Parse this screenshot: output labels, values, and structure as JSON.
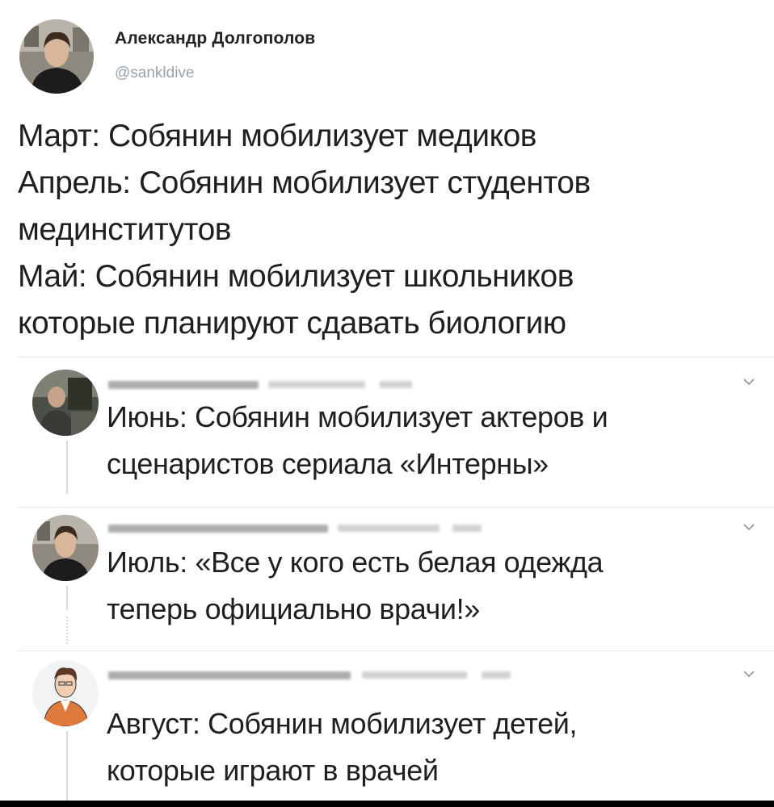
{
  "tweet": {
    "author_name": "Александр Долгополов",
    "author_handle": "@sankldive",
    "lines": [
      "Март: Собянин мобилизует медиков",
      "Апрель: Собянин мобилизует студентов",
      "мединститутов",
      "Май: Собянин мобилизует школьников",
      "которые планируют сдавать биологию"
    ]
  },
  "replies": [
    {
      "lines": [
        "Июнь: Собянин мобилизует актеров и",
        "сценаристов сериала «Интерны»"
      ]
    },
    {
      "lines": [
        "Июль: «Все у кого есть белая одежда",
        "теперь официально врачи!»"
      ]
    },
    {
      "lines": [
        "Август: Собянин мобилизует детей,",
        "которые играют в врачей"
      ]
    }
  ],
  "icons": {
    "chevron": "chevron-down-icon"
  },
  "colors": {
    "text": "#1f1f1f",
    "handle": "#9aa3ab",
    "separator": "#e3e6e8",
    "thread_line": "#d6dade"
  }
}
